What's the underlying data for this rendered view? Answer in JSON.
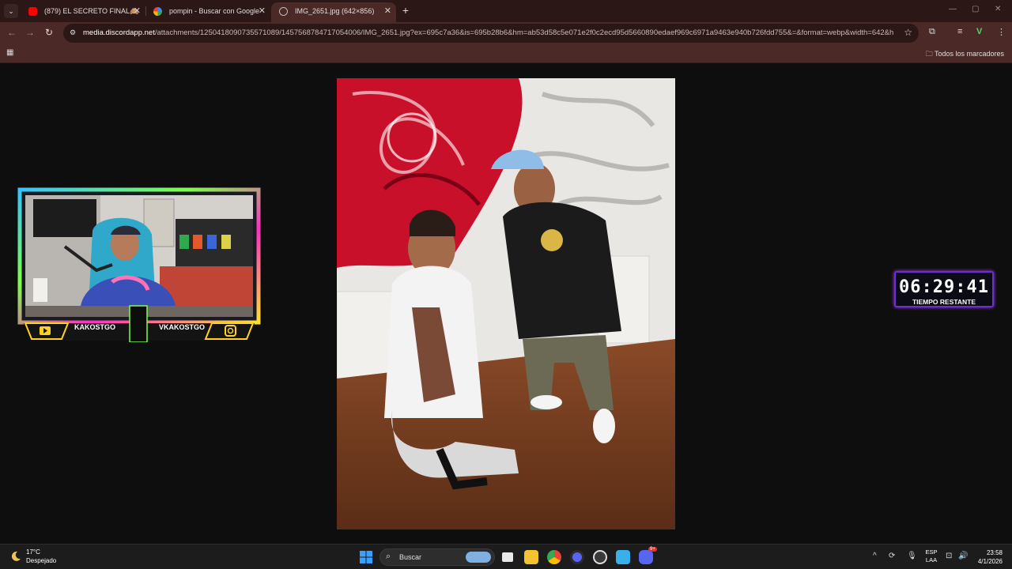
{
  "browser": {
    "tabs": [
      {
        "title": "(879) EL SECRETO FINAL🙈",
        "favicon": "youtube-icon",
        "active": false
      },
      {
        "title": "pompin - Buscar con Google",
        "favicon": "google-icon",
        "active": false
      },
      {
        "title": "IMG_2651.jpg (642×856)",
        "favicon": "globe-icon",
        "active": true
      }
    ],
    "url_domain": "media.discordapp.net",
    "url_path": "/attachments/1250418090735571089/1457568784717054006/IMG_2651.jpg?ex=695c7a36&is=695b28b6&hm=ab53d58c5e071e2f0c2ecd95d5660890edaef969c6971a9463e940b726fdd755&=&format=webp&width=642&heig...",
    "bookmarks_label": "Todos los marcadores"
  },
  "overlay": {
    "youtube_handle": "KAKOSTGO",
    "instagram_handle": "VKAKOSTGO",
    "timer_value": "06:29:41",
    "timer_label": "TIEMPO RESTANTE"
  },
  "taskbar": {
    "weather_temp": "17°C",
    "weather_desc": "Despejado",
    "search_placeholder": "Buscar",
    "lang_line1": "ESP",
    "lang_line2": "LAA",
    "time": "23:58",
    "date": "4/1/2026",
    "discord_badge": "9+"
  },
  "colors": {
    "tab_active": "#4a2926",
    "tabbar": "#2a1716",
    "timer_border": "#6b2fd1"
  }
}
